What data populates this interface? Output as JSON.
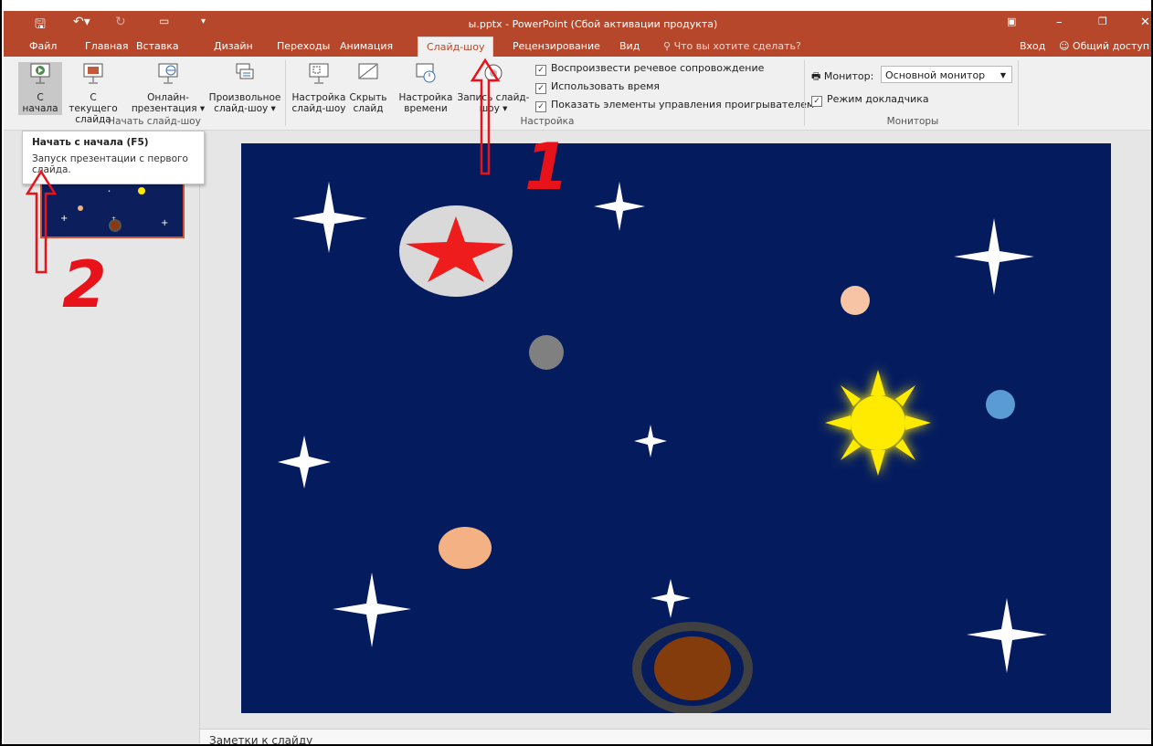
{
  "window": {
    "title": "ы.pptx - PowerPoint (Сбой активации продукта)",
    "login": "Вход",
    "share": "Общий доступ"
  },
  "tabs": [
    "Файл",
    "Главная",
    "Вставка",
    "Дизайн",
    "Переходы",
    "Анимация",
    "Слайд-шоу",
    "Рецензирование",
    "Вид"
  ],
  "active_tab": "Слайд-шоу",
  "tell_me": "Что вы хотите сделать?",
  "ribbon": {
    "start_group": {
      "label": "Начать слайд-шоу",
      "from_beginning": {
        "line1": "С",
        "line2": "начала"
      },
      "from_current": {
        "line1": "С текущего",
        "line2": "слайда"
      },
      "online": {
        "line1": "Онлайн-",
        "line2": "презентация ▾"
      },
      "custom": {
        "line1": "Произвольное",
        "line2": "слайд-шоу ▾"
      }
    },
    "setup_group": {
      "label": "Настройка",
      "setup_show": {
        "line1": "Настройка",
        "line2": "слайд-шоу"
      },
      "hide_slide": {
        "line1": "Скрыть",
        "line2": "слайд"
      },
      "rehearse": {
        "line1": "Настройка",
        "line2": "времени"
      },
      "record": {
        "line1": "Запись слайд-",
        "line2": "шоу ▾"
      },
      "checkboxes": [
        "Воспроизвести речевое сопровождение",
        "Использовать время",
        "Показать элементы управления проигрывателем"
      ]
    },
    "monitors_group": {
      "label": "Мониторы",
      "monitor_label": "Монитор:",
      "monitor_value": "Основной монитор",
      "presenter_view": "Режим докладчика"
    }
  },
  "tooltip": {
    "title": "Начать с начала (F5)",
    "body": "Запуск презентации с первого слайда."
  },
  "slide_number": "1",
  "notes_label": "Заметки к слайду",
  "annotations": {
    "label1": "1",
    "label2": "2",
    "color": "#e8121a"
  },
  "colors": {
    "accent": "#b7472a",
    "slide_bg": "#041c5e"
  }
}
